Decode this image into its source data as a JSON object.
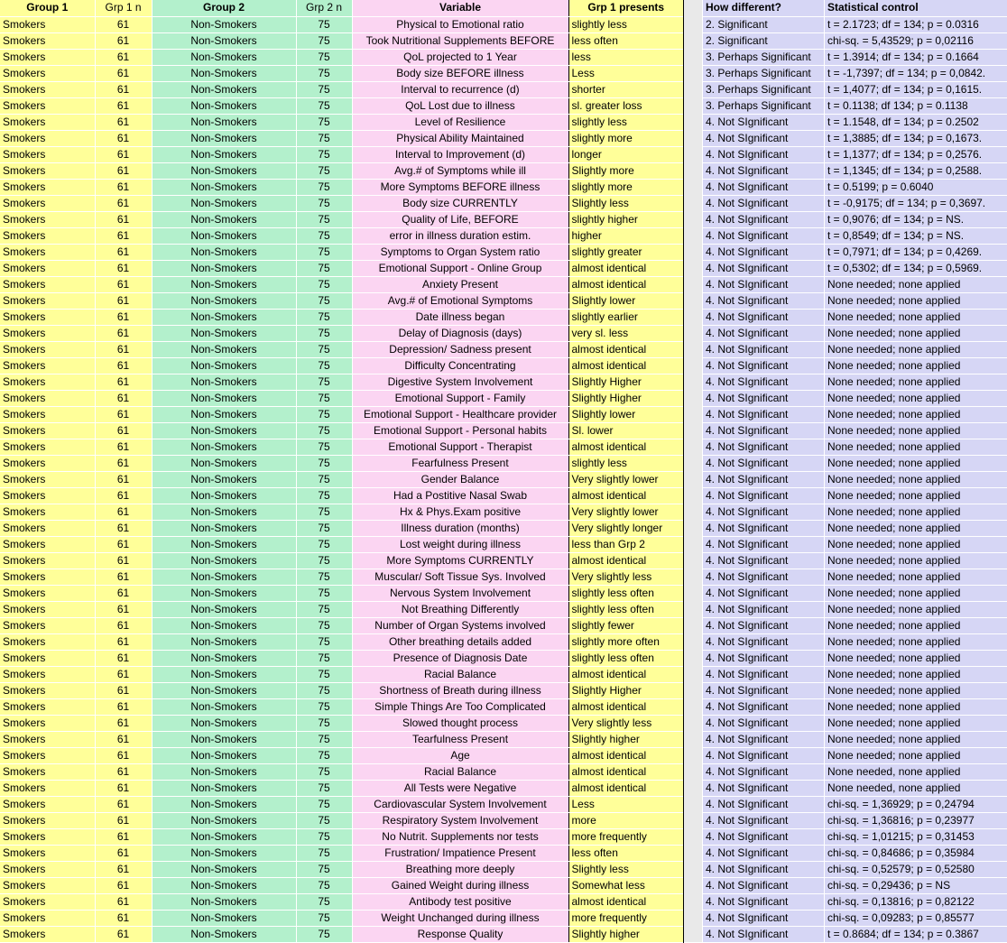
{
  "table": {
    "headers": {
      "group1": "Group 1",
      "grp1n": "Grp 1 n",
      "group2": "Group 2",
      "grp2n": "Grp 2 n",
      "variable": "Variable",
      "grp1_presents": "Grp 1 presents",
      "how_different": "How different?",
      "statistical_control": "Statistical control"
    },
    "colors": {
      "group1_fill": "#ffff99",
      "group2_fill": "#b3f0cc",
      "variable_fill": "#fbd5f2",
      "presents_fill": "#ffff99",
      "right_fill": "#d6d6f5",
      "gap_fill": "#e9e9e9"
    },
    "rows": [
      {
        "group1": "Smokers",
        "grp1n": "61",
        "group2": "Non-Smokers",
        "grp2n": "75",
        "variable": "Physical to Emotional ratio",
        "presents": "slightly less",
        "how": "2. Significant",
        "stat": "t = 2.1723; df = 134; p = 0.0316"
      },
      {
        "group1": "Smokers",
        "grp1n": "61",
        "group2": "Non-Smokers",
        "grp2n": "75",
        "variable": "Took Nutritional Supplements BEFORE",
        "presents": "less often",
        "how": "2. Significant",
        "stat": "chi-sq. = 5,43529;  p = 0,02116"
      },
      {
        "group1": "Smokers",
        "grp1n": "61",
        "group2": "Non-Smokers",
        "grp2n": "75",
        "variable": "QoL projected to 1 Year",
        "presents": "less",
        "how": "3. Perhaps Significant",
        "stat": "t = 1.3914; df = 134; p = 0.1664"
      },
      {
        "group1": "Smokers",
        "grp1n": "61",
        "group2": "Non-Smokers",
        "grp2n": "75",
        "variable": "Body size BEFORE illness",
        "presents": "Less",
        "how": "3. Perhaps Significant",
        "stat": "t = -1,7397; df = 134;  p = 0,0842."
      },
      {
        "group1": "Smokers",
        "grp1n": "61",
        "group2": "Non-Smokers",
        "grp2n": "75",
        "variable": "Interval to recurrence (d)",
        "presents": "shorter",
        "how": "3. Perhaps Significant",
        "stat": "t = 1,4077; df = 134;  p = 0,1615."
      },
      {
        "group1": "Smokers",
        "grp1n": "61",
        "group2": "Non-Smokers",
        "grp2n": "75",
        "variable": "QoL Lost due to illness",
        "presents": "sl. greater loss",
        "how": "3. Perhaps Significant",
        "stat": "t =  0.1138; df 134; p = 0.1138"
      },
      {
        "group1": "Smokers",
        "grp1n": "61",
        "group2": "Non-Smokers",
        "grp2n": "75",
        "variable": "Level of Resilience",
        "presents": "slightly less",
        "how": "4. Not SIgnificant",
        "stat": "t = 1.1548, df = 134; p = 0.2502"
      },
      {
        "group1": "Smokers",
        "grp1n": "61",
        "group2": "Non-Smokers",
        "grp2n": "75",
        "variable": "Physical Ability Maintained",
        "presents": "slightly more",
        "how": "4. Not SIgnificant",
        "stat": "t = 1,3885; df = 134;  p = 0,1673."
      },
      {
        "group1": "Smokers",
        "grp1n": "61",
        "group2": "Non-Smokers",
        "grp2n": "75",
        "variable": "Interval to Improvement (d)",
        "presents": "longer",
        "how": "4. Not SIgnificant",
        "stat": "t = 1,1377; df = 134;  p = 0,2576."
      },
      {
        "group1": "Smokers",
        "grp1n": "61",
        "group2": "Non-Smokers",
        "grp2n": "75",
        "variable": "Avg.# of Symptoms while ill",
        "presents": "Slightly more",
        "how": "4. Not SIgnificant",
        "stat": "t = 1,1345; df = 134;  p = 0,2588."
      },
      {
        "group1": "Smokers",
        "grp1n": "61",
        "group2": "Non-Smokers",
        "grp2n": "75",
        "variable": "More Symptoms BEFORE illness",
        "presents": "slightly more",
        "how": "4. Not SIgnificant",
        "stat": "t = 0.5199; p = 0.6040"
      },
      {
        "group1": "Smokers",
        "grp1n": "61",
        "group2": "Non-Smokers",
        "grp2n": "75",
        "variable": "Body size CURRENTLY",
        "presents": "Slightly less",
        "how": "4. Not SIgnificant",
        "stat": "t = -0,9175; df = 134;  p = 0,3697."
      },
      {
        "group1": "Smokers",
        "grp1n": "61",
        "group2": "Non-Smokers",
        "grp2n": "75",
        "variable": "Quality of Life, BEFORE",
        "presents": "slightly higher",
        "how": "4. Not SIgnificant",
        "stat": "t = 0,9076; df = 134;  p = NS."
      },
      {
        "group1": "Smokers",
        "grp1n": "61",
        "group2": "Non-Smokers",
        "grp2n": "75",
        "variable": "error in illness duration estim.",
        "presents": "higher",
        "how": "4. Not SIgnificant",
        "stat": "t = 0,8549; df = 134;  p = NS."
      },
      {
        "group1": "Smokers",
        "grp1n": "61",
        "group2": "Non-Smokers",
        "grp2n": "75",
        "variable": "Symptoms to Organ System ratio",
        "presents": "slightly greater",
        "how": "4. Not SIgnificant",
        "stat": "t = 0,7971; df = 134;  p = 0,4269."
      },
      {
        "group1": "Smokers",
        "grp1n": "61",
        "group2": "Non-Smokers",
        "grp2n": "75",
        "variable": "Emotional Support - Online Group",
        "presents": "almost identical",
        "how": "4. Not SIgnificant",
        "stat": "t = 0,5302; df = 134;  p = 0,5969."
      },
      {
        "group1": "Smokers",
        "grp1n": "61",
        "group2": "Non-Smokers",
        "grp2n": "75",
        "variable": "Anxiety Present",
        "presents": "almost identical",
        "how": "4. Not SIgnificant",
        "stat": "None needed; none applied"
      },
      {
        "group1": "Smokers",
        "grp1n": "61",
        "group2": "Non-Smokers",
        "grp2n": "75",
        "variable": "Avg.# of Emotional Symptoms",
        "presents": "Slightly lower",
        "how": "4. Not SIgnificant",
        "stat": "None needed; none applied"
      },
      {
        "group1": "Smokers",
        "grp1n": "61",
        "group2": "Non-Smokers",
        "grp2n": "75",
        "variable": "Date illness began",
        "presents": "slightly earlier",
        "how": "4. Not SIgnificant",
        "stat": "None needed; none applied"
      },
      {
        "group1": "Smokers",
        "grp1n": "61",
        "group2": "Non-Smokers",
        "grp2n": "75",
        "variable": "Delay of Diagnosis (days)",
        "presents": "very sl. less",
        "how": "4. Not SIgnificant",
        "stat": "None needed; none applied"
      },
      {
        "group1": "Smokers",
        "grp1n": "61",
        "group2": "Non-Smokers",
        "grp2n": "75",
        "variable": "Depression/ Sadness present",
        "presents": "almost identical",
        "how": "4. Not SIgnificant",
        "stat": "None needed; none applied"
      },
      {
        "group1": "Smokers",
        "grp1n": "61",
        "group2": "Non-Smokers",
        "grp2n": "75",
        "variable": "Difficulty Concentrating",
        "presents": "almost identical",
        "how": "4. Not SIgnificant",
        "stat": "None needed; none applied"
      },
      {
        "group1": "Smokers",
        "grp1n": "61",
        "group2": "Non-Smokers",
        "grp2n": "75",
        "variable": "Digestive System Involvement",
        "presents": "Slightly Higher",
        "how": "4. Not SIgnificant",
        "stat": "None needed; none applied"
      },
      {
        "group1": "Smokers",
        "grp1n": "61",
        "group2": "Non-Smokers",
        "grp2n": "75",
        "variable": "Emotional Support - Family",
        "presents": "Slightly Higher",
        "how": "4. Not SIgnificant",
        "stat": "None needed; none applied"
      },
      {
        "group1": "Smokers",
        "grp1n": "61",
        "group2": "Non-Smokers",
        "grp2n": "75",
        "variable": "Emotional Support - Healthcare provider",
        "presents": "Slightly lower",
        "how": "4. Not SIgnificant",
        "stat": "None needed; none applied"
      },
      {
        "group1": "Smokers",
        "grp1n": "61",
        "group2": "Non-Smokers",
        "grp2n": "75",
        "variable": "Emotional Support - Personal habits",
        "presents": "Sl. lower",
        "how": "4. Not SIgnificant",
        "stat": "None needed; none applied"
      },
      {
        "group1": "Smokers",
        "grp1n": "61",
        "group2": "Non-Smokers",
        "grp2n": "75",
        "variable": "Emotional Support - Therapist",
        "presents": "almost identical",
        "how": "4. Not SIgnificant",
        "stat": "None needed; none applied"
      },
      {
        "group1": "Smokers",
        "grp1n": "61",
        "group2": "Non-Smokers",
        "grp2n": "75",
        "variable": "Fearfulness Present",
        "presents": "slightly less",
        "how": "4. Not SIgnificant",
        "stat": "None needed; none applied"
      },
      {
        "group1": "Smokers",
        "grp1n": "61",
        "group2": "Non-Smokers",
        "grp2n": "75",
        "variable": "Gender Balance",
        "presents": "Very slightly lower",
        "how": "4. Not SIgnificant",
        "stat": "None needed; none applied"
      },
      {
        "group1": "Smokers",
        "grp1n": "61",
        "group2": "Non-Smokers",
        "grp2n": "75",
        "variable": "Had a Postitive Nasal Swab",
        "presents": "almost identical",
        "how": "4. Not SIgnificant",
        "stat": "None needed; none applied"
      },
      {
        "group1": "Smokers",
        "grp1n": "61",
        "group2": "Non-Smokers",
        "grp2n": "75",
        "variable": "Hx & Phys.Exam positive",
        "presents": "Very slightly lower",
        "how": "4. Not SIgnificant",
        "stat": "None needed; none applied"
      },
      {
        "group1": "Smokers",
        "grp1n": "61",
        "group2": "Non-Smokers",
        "grp2n": "75",
        "variable": "Illness duration (months)",
        "presents": "Very slightly longer",
        "how": "4. Not SIgnificant",
        "stat": "None needed; none applied"
      },
      {
        "group1": "Smokers",
        "grp1n": "61",
        "group2": "Non-Smokers",
        "grp2n": "75",
        "variable": "Lost weight during illness",
        "presents": "less than Grp 2",
        "how": "4. Not SIgnificant",
        "stat": "None needed; none applied"
      },
      {
        "group1": "Smokers",
        "grp1n": "61",
        "group2": "Non-Smokers",
        "grp2n": "75",
        "variable": "More Symptoms CURRENTLY",
        "presents": "almost identical",
        "how": "4. Not SIgnificant",
        "stat": "None needed; none applied"
      },
      {
        "group1": "Smokers",
        "grp1n": "61",
        "group2": "Non-Smokers",
        "grp2n": "75",
        "variable": "Muscular/ Soft Tissue Sys. Involved",
        "presents": "Very slightly less",
        "how": "4. Not SIgnificant",
        "stat": "None needed; none applied"
      },
      {
        "group1": "Smokers",
        "grp1n": "61",
        "group2": "Non-Smokers",
        "grp2n": "75",
        "variable": "Nervous System Involvement",
        "presents": "slightly less often",
        "how": "4. Not SIgnificant",
        "stat": "None needed; none applied"
      },
      {
        "group1": "Smokers",
        "grp1n": "61",
        "group2": "Non-Smokers",
        "grp2n": "75",
        "variable": "Not Breathing Differently",
        "presents": "slightly less often",
        "how": "4. Not SIgnificant",
        "stat": "None needed; none applied"
      },
      {
        "group1": "Smokers",
        "grp1n": "61",
        "group2": "Non-Smokers",
        "grp2n": "75",
        "variable": "Number of Organ Systems involved",
        "presents": "slightly fewer",
        "how": "4. Not SIgnificant",
        "stat": "None needed; none applied"
      },
      {
        "group1": "Smokers",
        "grp1n": "61",
        "group2": "Non-Smokers",
        "grp2n": "75",
        "variable": "Other breathing details added",
        "presents": "slightly more often",
        "how": "4. Not SIgnificant",
        "stat": "None needed; none applied"
      },
      {
        "group1": "Smokers",
        "grp1n": "61",
        "group2": "Non-Smokers",
        "grp2n": "75",
        "variable": "Presence of Diagnosis Date",
        "presents": "slightly less often",
        "how": "4. Not SIgnificant",
        "stat": "None needed; none applied"
      },
      {
        "group1": "Smokers",
        "grp1n": "61",
        "group2": "Non-Smokers",
        "grp2n": "75",
        "variable": "Racial Balance",
        "presents": "almost identical",
        "how": "4. Not SIgnificant",
        "stat": "None needed; none applied"
      },
      {
        "group1": "Smokers",
        "grp1n": "61",
        "group2": "Non-Smokers",
        "grp2n": "75",
        "variable": "Shortness of Breath during illness",
        "presents": "Slightly Higher",
        "how": "4. Not SIgnificant",
        "stat": "None needed; none applied"
      },
      {
        "group1": "Smokers",
        "grp1n": "61",
        "group2": "Non-Smokers",
        "grp2n": "75",
        "variable": "Simple Things Are Too Complicated",
        "presents": "almost identical",
        "how": "4. Not SIgnificant",
        "stat": "None needed; none applied"
      },
      {
        "group1": "Smokers",
        "grp1n": "61",
        "group2": "Non-Smokers",
        "grp2n": "75",
        "variable": "Slowed thought process",
        "presents": "Very slightly less",
        "how": "4. Not SIgnificant",
        "stat": "None needed; none applied"
      },
      {
        "group1": "Smokers",
        "grp1n": "61",
        "group2": "Non-Smokers",
        "grp2n": "75",
        "variable": "Tearfulness Present",
        "presents": "Slightly higher",
        "how": "4. Not SIgnificant",
        "stat": "None needed; none applied"
      },
      {
        "group1": "Smokers",
        "grp1n": "61",
        "group2": "Non-Smokers",
        "grp2n": "75",
        "variable": "Age",
        "presents": "almost identical",
        "how": "4. Not SIgnificant",
        "stat": "None needed; none applied"
      },
      {
        "group1": "Smokers",
        "grp1n": "61",
        "group2": "Non-Smokers",
        "grp2n": "75",
        "variable": "Racial Balance",
        "presents": "almost identical",
        "how": "4. Not SIgnificant",
        "stat": "None needed, none applied"
      },
      {
        "group1": "Smokers",
        "grp1n": "61",
        "group2": "Non-Smokers",
        "grp2n": "75",
        "variable": "All Tests were Negative",
        "presents": "almost identical",
        "how": "4. Not SIgnificant",
        "stat": "None needed, none applied"
      },
      {
        "group1": "Smokers",
        "grp1n": "61",
        "group2": "Non-Smokers",
        "grp2n": "75",
        "variable": "Cardiovascular System Involvement",
        "presents": "Less",
        "how": "4. Not SIgnificant",
        "stat": "chi-sq. = 1,36929;  p = 0,24794"
      },
      {
        "group1": "Smokers",
        "grp1n": "61",
        "group2": "Non-Smokers",
        "grp2n": "75",
        "variable": "Respiratory System Involvement",
        "presents": "more",
        "how": "4. Not SIgnificant",
        "stat": "chi-sq. = 1,36816;  p = 0,23977"
      },
      {
        "group1": "Smokers",
        "grp1n": "61",
        "group2": "Non-Smokers",
        "grp2n": "75",
        "variable": "No Nutrit. Supplements nor tests",
        "presents": "more frequently",
        "how": "4. Not SIgnificant",
        "stat": "chi-sq. = 1,01215;  p = 0,31453"
      },
      {
        "group1": "Smokers",
        "grp1n": "61",
        "group2": "Non-Smokers",
        "grp2n": "75",
        "variable": "Frustration/ Impatience Present",
        "presents": "less often",
        "how": "4. Not SIgnificant",
        "stat": "chi-sq. = 0,84686;  p = 0,35984"
      },
      {
        "group1": "Smokers",
        "grp1n": "61",
        "group2": "Non-Smokers",
        "grp2n": "75",
        "variable": "Breathing more deeply",
        "presents": "Slightly less",
        "how": "4. Not SIgnificant",
        "stat": "chi-sq. = 0,52579;  p = 0,52580"
      },
      {
        "group1": "Smokers",
        "grp1n": "61",
        "group2": "Non-Smokers",
        "grp2n": "75",
        "variable": "Gained Weight during illness",
        "presents": "Somewhat less",
        "how": "4. Not SIgnificant",
        "stat": "chi-sq. = 0,29436;  p = NS"
      },
      {
        "group1": "Smokers",
        "grp1n": "61",
        "group2": "Non-Smokers",
        "grp2n": "75",
        "variable": "Antibody test positive",
        "presents": "almost identical",
        "how": "4. Not SIgnificant",
        "stat": "chi-sq. = 0,13816;  p = 0,82122"
      },
      {
        "group1": "Smokers",
        "grp1n": "61",
        "group2": "Non-Smokers",
        "grp2n": "75",
        "variable": "Weight Unchanged during illness",
        "presents": "more frequently",
        "how": "4. Not SIgnificant",
        "stat": "chi-sq. = 0,09283;  p = 0,85577"
      },
      {
        "group1": "Smokers",
        "grp1n": "61",
        "group2": "Non-Smokers",
        "grp2n": "75",
        "variable": "Response Quality",
        "presents": "Slightly higher",
        "how": "4. Not SIgnificant",
        "stat": " t = 0.8684; df = 134; p = 0.3867"
      }
    ]
  }
}
